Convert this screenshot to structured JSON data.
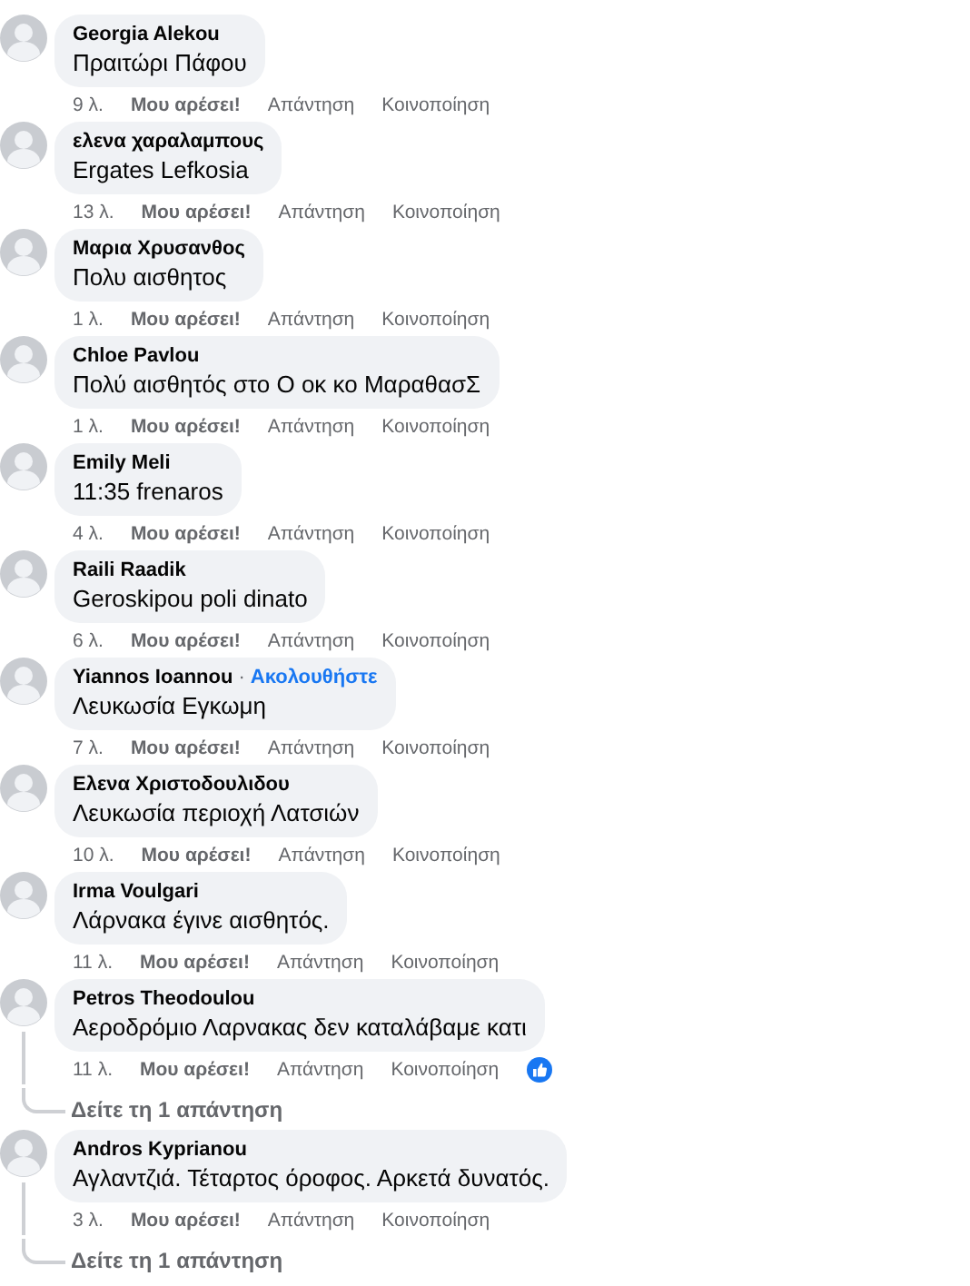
{
  "comments": [
    {
      "author": "Georgia Alekou",
      "text": "Πραιτώρι Πάφου",
      "time": "9 λ.",
      "like": "Μου αρέσει!",
      "reply": "Απάντηση",
      "share": "Κοινοποίηση"
    },
    {
      "author": "ελενα χαραλαμπους",
      "text": "Ergates Lefkosia",
      "time": "13 λ.",
      "like": "Μου αρέσει!",
      "reply": "Απάντηση",
      "share": "Κοινοποίηση"
    },
    {
      "author": "Μαρια Χρυσανθος",
      "text": "Πολυ αισθητος",
      "time": "1 λ.",
      "like": "Μου αρέσει!",
      "reply": "Απάντηση",
      "share": "Κοινοποίηση"
    },
    {
      "author": "Chloe Pavlou",
      "text": "Πολύ αισθητός στο Ο οκ κο ΜαραθασΣ",
      "time": "1 λ.",
      "like": "Μου αρέσει!",
      "reply": "Απάντηση",
      "share": "Κοινοποίηση"
    },
    {
      "author": "Emily Meli",
      "text": "11:35 frenaros",
      "time": "4 λ.",
      "like": "Μου αρέσει!",
      "reply": "Απάντηση",
      "share": "Κοινοποίηση"
    },
    {
      "author": "Raili Raadik",
      "text": "Geroskipou poli dinato",
      "time": "6 λ.",
      "like": "Μου αρέσει!",
      "reply": "Απάντηση",
      "share": "Κοινοποίηση"
    },
    {
      "author": "Yiannos Ioannou",
      "separator": "·",
      "follow": "Ακολουθήστε",
      "text": "Λευκωσία Εγκωμη",
      "time": "7 λ.",
      "like": "Μου αρέσει!",
      "reply": "Απάντηση",
      "share": "Κοινοποίηση"
    },
    {
      "author": "Ελενα Χριστοδουλιδου",
      "text": "Λευκωσία περιοχή Λατσιών",
      "time": "10 λ.",
      "like": "Μου αρέσει!",
      "reply": "Απάντηση",
      "share": "Κοινοποίηση"
    },
    {
      "author": "Irma Voulgari",
      "text": "Λάρνακα έγινε αισθητός.",
      "time": "11 λ.",
      "like": "Μου αρέσει!",
      "reply": "Απάντηση",
      "share": "Κοινοποίηση"
    },
    {
      "author": "Petros Theodoulou",
      "text": "Αεροδρόμιο Λαρνακας δεν καταλάβαμε κατι",
      "time": "11 λ.",
      "like": "Μου αρέσει!",
      "reply": "Απάντηση",
      "share": "Κοινοποίηση",
      "reactions": [
        {
          "kind": "like"
        }
      ],
      "replies_link": "Δείτε τη 1 απάντηση"
    },
    {
      "author": "Andros Kyprianou",
      "text": "Αγλαντζιά. Τέταρτος όροφος. Αρκετά δυνατός.",
      "time": "3 λ.",
      "like": "Μου αρέσει!",
      "reply": "Απάντηση",
      "share": "Κοινοποίηση",
      "replies_link": "Δείτε τη 1 απάντηση"
    }
  ]
}
